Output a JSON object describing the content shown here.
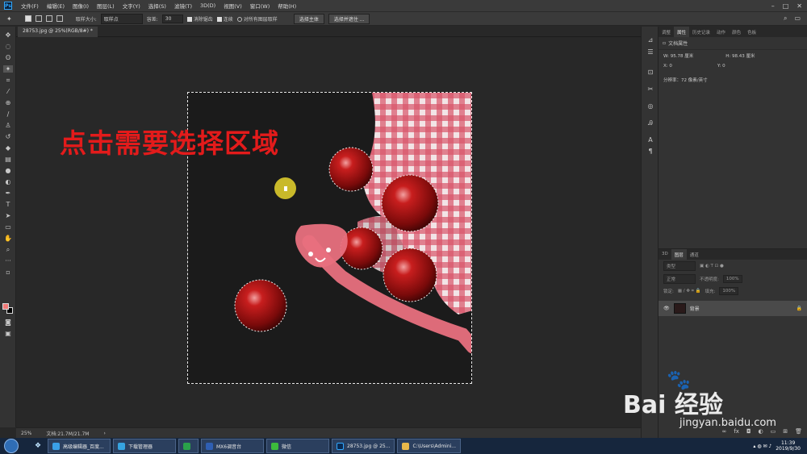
{
  "app": {
    "logo": "Ps"
  },
  "menu": [
    "文件(F)",
    "编辑(E)",
    "图像(I)",
    "图层(L)",
    "文字(Y)",
    "选择(S)",
    "滤镜(T)",
    "3D(D)",
    "视图(V)",
    "窗口(W)",
    "帮助(H)"
  ],
  "options": {
    "sample_size_label": "取样大小:",
    "sample_size_value": "取样点",
    "tolerance_label": "容差:",
    "tolerance_value": "30",
    "antialias_label": "消除锯齿",
    "contiguous_label": "连续",
    "all_layers_label": "对所有图层取样",
    "select_subject": "选择主体",
    "select_mask": "选择并遮住 ..."
  },
  "document": {
    "tab_title": "28753.jpg @ 25%(RGB/8#) *"
  },
  "canvas": {
    "overlay_text": "点击需要选择区域"
  },
  "status": {
    "zoom": "25%",
    "doc_info": "文档:21.7M/21.7M"
  },
  "properties": {
    "tabs": [
      "调整",
      "属性",
      "历史记录",
      "动作",
      "颜色",
      "色板"
    ],
    "active_tab": "属性",
    "title": "文档属性",
    "w_label": "W:",
    "w_value": "95.78 厘米",
    "h_label": "H:",
    "h_value": "98.43 厘米",
    "x_label": "X:",
    "x_value": "0",
    "y_label": "Y:",
    "y_value": "0",
    "resolution": "分辨率：72 像素/英寸"
  },
  "layers": {
    "tabs": [
      "3D",
      "图层",
      "通道"
    ],
    "active_tab": "图层",
    "filter_placeholder": "类型",
    "blend_mode": "正常",
    "opacity_label": "不透明度:",
    "opacity_value": "100%",
    "lock_label": "锁定:",
    "fill_label": "填充:",
    "fill_value": "100%",
    "layer_name": "背景"
  },
  "taskbar": {
    "items": [
      {
        "label": "高级编辑器_百度...",
        "color": "#3aa0e8"
      },
      {
        "label": "下载管理器",
        "color": "#36a3e0"
      },
      {
        "label": "",
        "color": "#2aa14a"
      },
      {
        "label": "MX6调音台",
        "color": "#2f5fb3"
      },
      {
        "label": "微信",
        "color": "#3cba3c"
      },
      {
        "label": "28753.jpg @ 25...",
        "color": "#0a2a52"
      },
      {
        "label": "C:\\Users\\Admini...",
        "color": "#e8b84a"
      }
    ],
    "time": "11:39",
    "date": "2019/9/30"
  },
  "watermark": {
    "name": "Bai 经验",
    "url": "jingyan.baidu.com"
  },
  "colors": {
    "overlay_text": "#e31b1b",
    "accent": "#31a8ff",
    "foreground_swatch": "#f07a78"
  }
}
